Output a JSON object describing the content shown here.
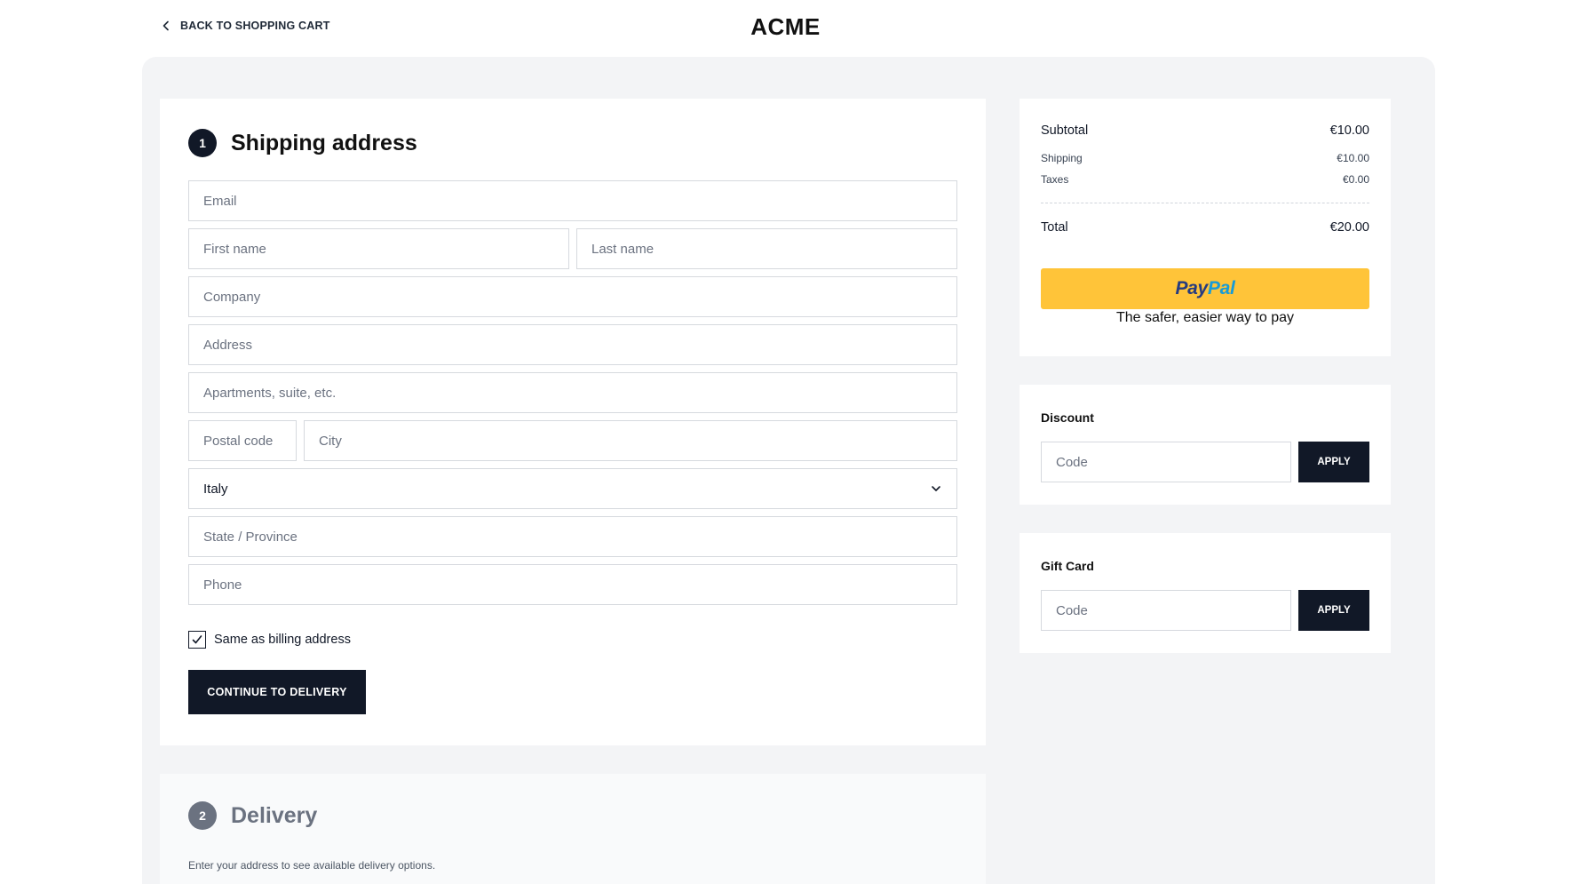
{
  "header": {
    "back_label": "BACK TO SHOPPING CART",
    "brand": "ACME"
  },
  "shipping": {
    "step": "1",
    "title": "Shipping address",
    "fields": {
      "email": "Email",
      "first_name": "First name",
      "last_name": "Last name",
      "company": "Company",
      "address": "Address",
      "apartment": "Apartments, suite, etc.",
      "postal_code": "Postal code",
      "city": "City",
      "country_value": "Italy",
      "state": "State / Province",
      "phone": "Phone"
    },
    "same_billing_label": "Same as billing address",
    "same_billing_checked": true,
    "continue_label": "CONTINUE TO DELIVERY"
  },
  "delivery": {
    "step": "2",
    "title": "Delivery",
    "description": "Enter your address to see available delivery options."
  },
  "summary": {
    "subtotal_label": "Subtotal",
    "subtotal_value": "€10.00",
    "shipping_label": "Shipping",
    "shipping_value": "€10.00",
    "taxes_label": "Taxes",
    "taxes_value": "€0.00",
    "total_label": "Total",
    "total_value": "€20.00",
    "paypal_logo_a": "Pay",
    "paypal_logo_b": "Pal",
    "paypal_tagline": "The safer, easier way to pay"
  },
  "discount": {
    "title": "Discount",
    "placeholder": "Code",
    "apply_label": "APPLY"
  },
  "gift_card": {
    "title": "Gift Card",
    "placeholder": "Code",
    "apply_label": "APPLY"
  },
  "colors": {
    "primary": "#111827",
    "paypal_yellow": "#ffc439",
    "paypal_dark_blue": "#253b80",
    "paypal_light_blue": "#179bd7",
    "page_background": "#f3f4f6"
  }
}
